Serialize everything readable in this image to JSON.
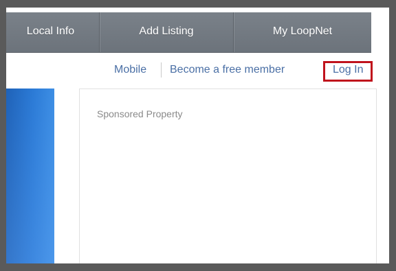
{
  "nav": {
    "items": [
      {
        "label": "Local Info"
      },
      {
        "label": "Add Listing"
      },
      {
        "label": "My LoopNet"
      }
    ]
  },
  "utility": {
    "mobile": "Mobile",
    "become_member": "Become a free member",
    "login": "Log In"
  },
  "sponsored": {
    "label": "Sponsored Property"
  },
  "colors": {
    "nav_bg": "#727980",
    "link": "#4a6fa5",
    "highlight_box": "#c0121c",
    "panel_blue": "#2b7ad6"
  }
}
